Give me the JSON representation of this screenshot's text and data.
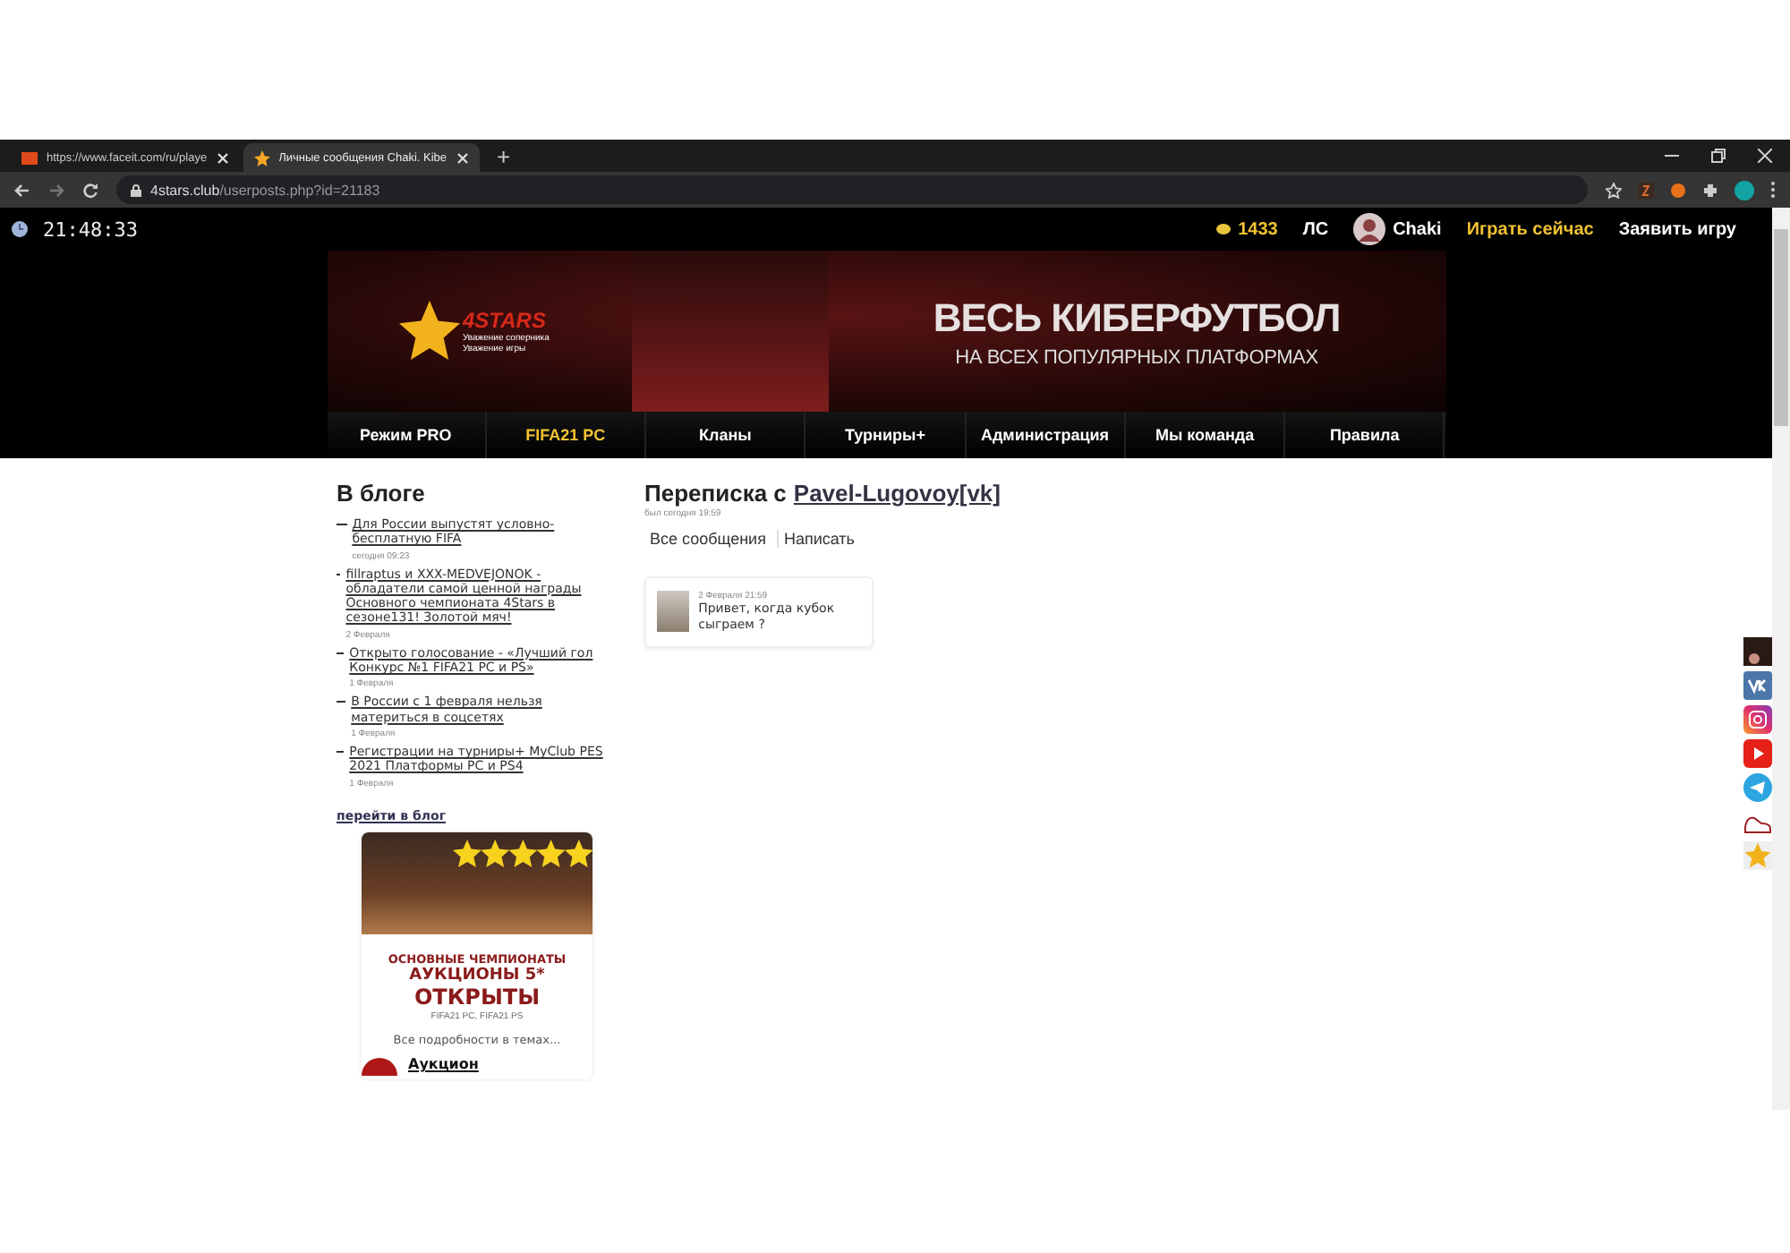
{
  "browser": {
    "tabs": [
      {
        "title": "https://www.faceit.com/ru/playe",
        "selected": false
      },
      {
        "title": "Личные сообщения Chaki. Kibe",
        "selected": true
      }
    ],
    "new_tab": "+",
    "address": {
      "host": "4stars.club",
      "path": "/userposts.php?id=21183"
    }
  },
  "topbar": {
    "clock": "21:48:33",
    "coins": "1433",
    "messages": "ЛС",
    "username": "Chaki",
    "play_now": "Играть сейчас",
    "declare_game": "Заявить игру"
  },
  "banner": {
    "logo": "4STARS",
    "logo_tagline": "Уважение соперника Уважение игры",
    "headline": "ВЕСЬ КИБЕРФУТБОЛ",
    "subheadline": "НА ВСЕХ ПОПУЛЯРНЫХ ПЛАТФОРМАХ"
  },
  "nav": [
    {
      "label": "Режим PRO",
      "selected": false
    },
    {
      "label": "FIFA21 PC",
      "selected": true
    },
    {
      "label": "Кланы",
      "selected": false
    },
    {
      "label": "Турниры+",
      "selected": false
    },
    {
      "label": "Администрация",
      "selected": false
    },
    {
      "label": "Мы команда",
      "selected": false
    },
    {
      "label": "Правила",
      "selected": false
    }
  ],
  "blog": {
    "title": "В блоге",
    "posts": [
      {
        "title": "Для России выпустят условно-бесплатную FIFA",
        "date": "сегодня 09:23"
      },
      {
        "title": "fillraptus и XXX-MEDVEJONOK - обладатели самой ценной награды Основного чемпионата 4Stars в сезоне131! Золотой мяч!",
        "date": "2 Февраля"
      },
      {
        "title": "Открыто голосование - «Лучший гол Конкурс №1 FIFA21 PC и PS»",
        "date": "1 Февраля"
      },
      {
        "title": "В России с 1 февраля нельзя материться в соцсетях",
        "date": "1 Февраля"
      },
      {
        "title": "Регистрации на турниры+ MyClub PES 2021 Платформы PC и PS4",
        "date": "1 Февраля"
      }
    ],
    "more_link": "перейти в блог"
  },
  "promo": {
    "line_1": "ОСНОВНЫЕ ЧЕМПИОНАТЫ",
    "line_2": "АУКЦИОНЫ 5*",
    "line_3": "ОТКРЫТЫ",
    "platforms": "FIFA21 PC, FIFA21 PS",
    "details": "Все подробности в темах...",
    "topic": "Аукцион"
  },
  "conversation": {
    "title": "Переписка с",
    "partner": "Pavel-Lugovoy[vk]",
    "last_seen": "был сегодня 19:59",
    "actions": [
      "Все сообщения",
      "Написать"
    ],
    "messages": [
      {
        "date": "2 Февраля 21:59",
        "text": "Привет, когда кубок сыграем ?"
      }
    ]
  },
  "social": [
    {
      "kind": "photo"
    },
    {
      "kind": "vk"
    },
    {
      "kind": "instagram"
    },
    {
      "kind": "youtube"
    },
    {
      "kind": "telegram"
    },
    {
      "kind": "shoe"
    },
    {
      "kind": "star"
    }
  ]
}
